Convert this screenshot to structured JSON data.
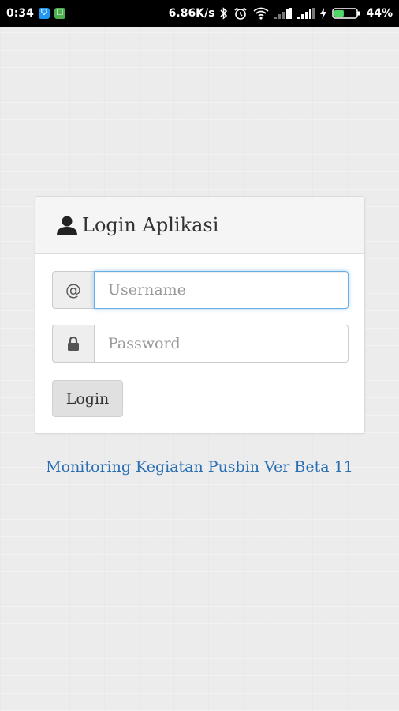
{
  "status_bar": {
    "time": "0:34",
    "net_speed": "6.86K/s",
    "battery_percent": "44%",
    "battery_level": 0.44,
    "icons": [
      "shield-app-icon",
      "android-app-icon",
      "bluetooth-icon",
      "alarm-icon",
      "wifi-icon",
      "signal-icon",
      "signal-icon",
      "charging-icon",
      "battery-icon"
    ],
    "colors": {
      "app1": "#2196f3",
      "app2": "#4caf50",
      "battery": "#4cd964"
    }
  },
  "login": {
    "title": "Login Aplikasi",
    "username_addon": "@",
    "username_placeholder": "Username",
    "password_placeholder": "Password",
    "button_label": "Login"
  },
  "footer": {
    "link_text": "Monitoring Kegiatan Pusbin Ver Beta 11",
    "link_color": "#2a6fb3"
  }
}
